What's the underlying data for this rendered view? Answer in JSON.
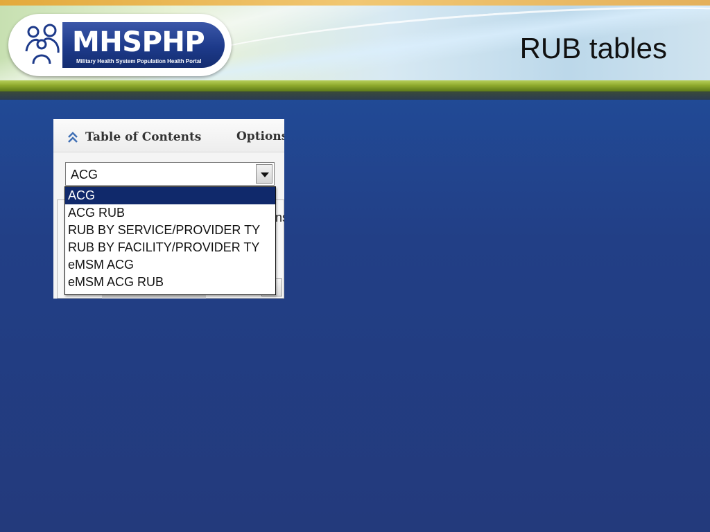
{
  "logo": {
    "name": "MHSPHP",
    "tagline": "Military Health System Population Health Portal",
    "icon": "family-emblem-icon"
  },
  "slide": {
    "title": "RUB tables"
  },
  "panel": {
    "header_title": "Table of Contents",
    "header_options": "Options",
    "collapse_icon": "double-chevron-up-icon",
    "select_value": "ACG",
    "behind_label": "ns",
    "dropdown_items": [
      "ACG",
      "ACG RUB",
      "RUB BY SERVICE/PROVIDER TY",
      "RUB BY FACILITY/PROVIDER TY",
      "eMSM ACG",
      "eMSM ACG RUB"
    ],
    "selected_index": 0
  },
  "colors": {
    "slide_bg": "#223f86",
    "selected_bg": "#10296b",
    "logo_blue": "#1d3a8a",
    "header_green": "#8faa2d"
  }
}
